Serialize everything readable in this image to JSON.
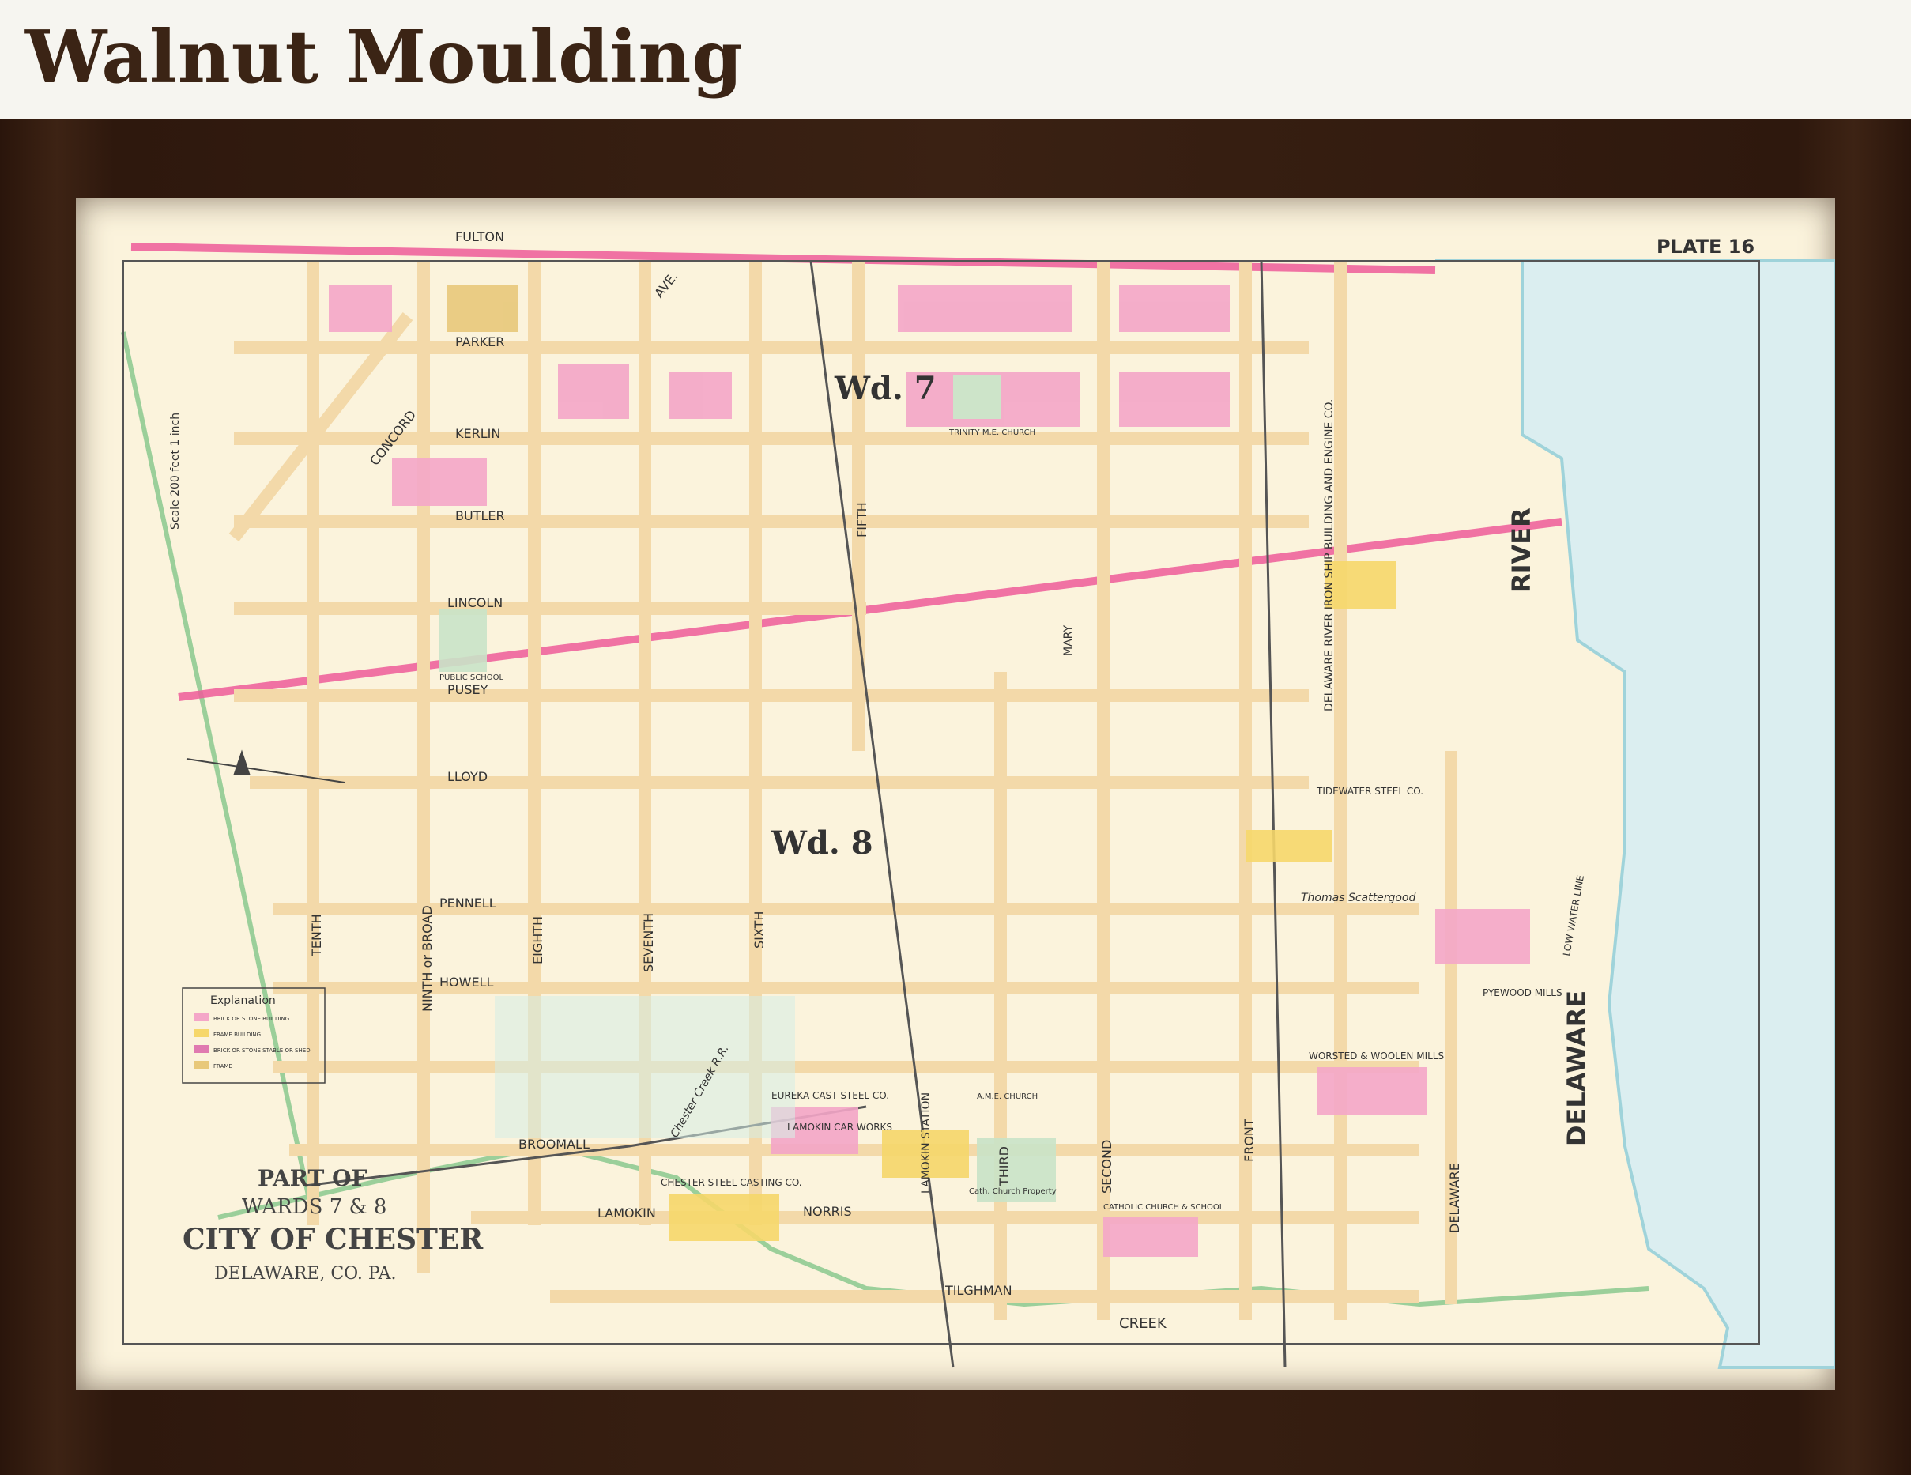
{
  "header": {
    "title": "Walnut Moulding"
  },
  "map": {
    "plate": "PLATE 16",
    "scale": "Scale 200 feet 1 inch",
    "wards": [
      "Wd. 7",
      "Wd. 8"
    ],
    "title_lines": [
      "PART OF",
      "WARDS 7 & 8",
      "CITY OF CHESTER",
      "DELAWARE, CO. PA."
    ],
    "river": [
      "RIVER",
      "DELAWARE"
    ],
    "creek": [
      "LAMOKIN",
      "CREEK"
    ],
    "legend": {
      "title": "Explanation",
      "items": [
        "BRICK OR STONE BUILDING",
        "FRAME BUILDING",
        "BRICK OR STONE STABLE OR SHED",
        "FRAME"
      ]
    },
    "streets_h": [
      "FULTON",
      "PARKER",
      "KERLIN",
      "BUTLER",
      "LINCOLN",
      "PUSEY",
      "LLOYD",
      "PENNELL",
      "HOWELL",
      "BROOMALL",
      "NORRIS",
      "TILGHMAN",
      "CONCORD",
      "AVE."
    ],
    "streets_v": [
      "TENTH",
      "NINTH or BROAD",
      "EIGHTH",
      "SEVENTH",
      "SIXTH",
      "FIFTH",
      "THIRD",
      "SECOND",
      "FRONT",
      "DELAWARE",
      "LAMOKIN STATION",
      "MARY"
    ],
    "labels": [
      "TRINITY M.E. CHURCH",
      "PUBLIC SCHOOL",
      "TIDEWATER STEEL CO.",
      "EUREKA CAST STEEL CO.",
      "LAMOKIN CAR WORKS",
      "CHESTER STEEL CASTING CO.",
      "DELAWARE RIVER IRON SHIP BUILDING AND ENGINE CO.",
      "WORSTED & WOOLEN MILLS",
      "PYEWOOD MILLS",
      "CATHOLIC CHURCH & SCHOOL",
      "A.M.E. CHURCH",
      "Thomas Scattergood",
      "Cath. Church Property",
      "LOW WATER LINE",
      "Chester Creek R.R."
    ]
  }
}
